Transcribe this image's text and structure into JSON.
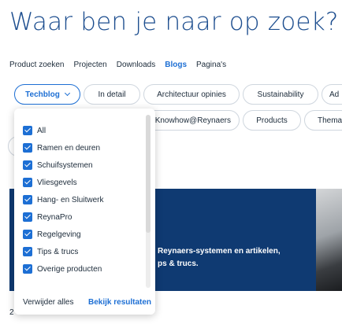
{
  "page": {
    "title": "Waar ben je naar op zoek?"
  },
  "tabs": [
    {
      "label": "Product zoeken"
    },
    {
      "label": "Projecten"
    },
    {
      "label": "Downloads"
    },
    {
      "label": "Blogs",
      "active": true
    },
    {
      "label": "Pagina's"
    }
  ],
  "filters": {
    "row1": [
      "Techblog",
      "In detail",
      "Architectuur opinies",
      "Sustainability",
      "Ad"
    ],
    "row2": [
      "Knowhow@Reynaers",
      "Products",
      "Thema"
    ]
  },
  "dropdown": {
    "options": [
      {
        "label": "All",
        "checked": true
      },
      {
        "label": "Ramen en deuren",
        "checked": true
      },
      {
        "label": "Schuifsystemen",
        "checked": true
      },
      {
        "label": "Vliesgevels",
        "checked": true
      },
      {
        "label": "Hang- en Sluitwerk",
        "checked": true
      },
      {
        "label": "ReynaPro",
        "checked": true
      },
      {
        "label": "Regelgeving",
        "checked": true
      },
      {
        "label": "Tips & trucs",
        "checked": true
      },
      {
        "label": "Overige producten",
        "checked": true
      }
    ],
    "clear_label": "Verwijder alles",
    "apply_label": "Bekijk resultaten"
  },
  "hero": {
    "line1": "Reynaers-systemen en artikelen,",
    "line2": "ps & trucs."
  },
  "results_text": "2",
  "colors": {
    "accent": "#1d6fd4",
    "heading": "#1d4e8f",
    "hero_bg": "#0f3a72"
  }
}
